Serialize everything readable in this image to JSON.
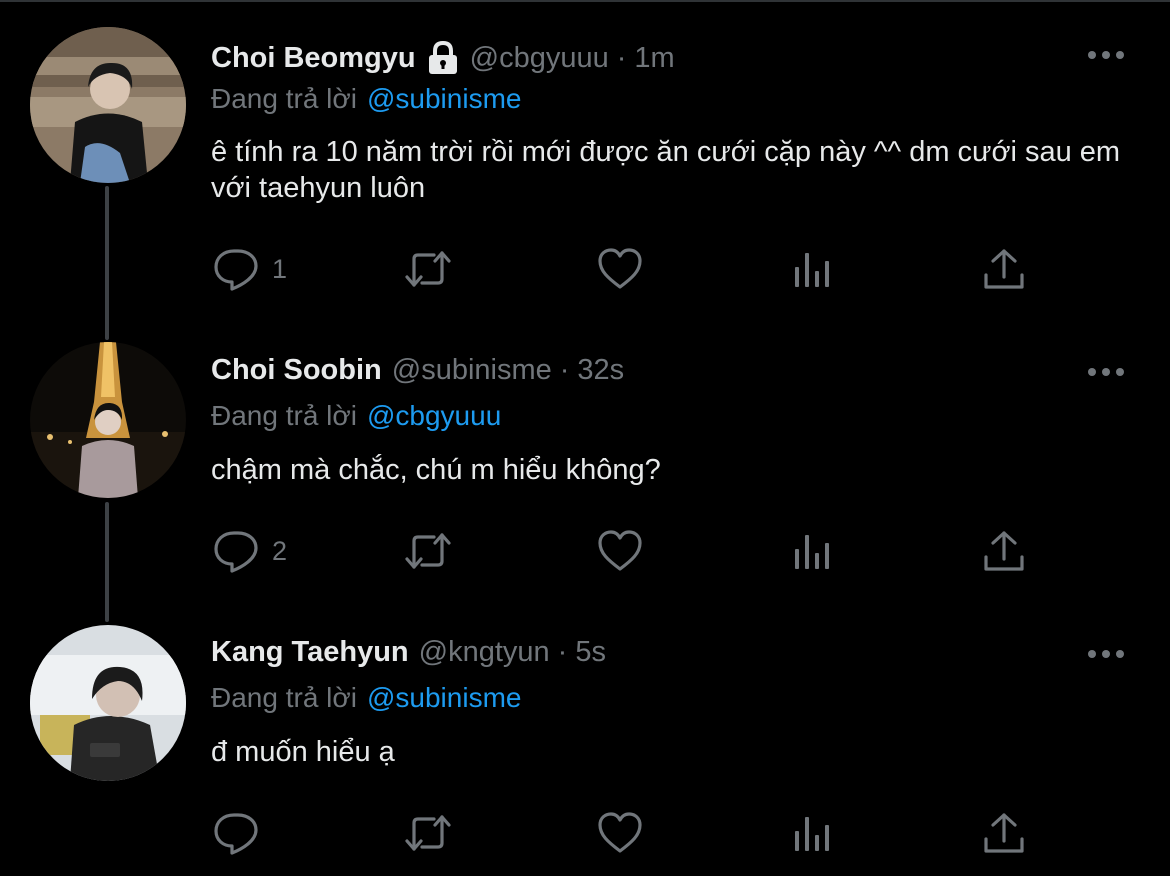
{
  "colors": {
    "background": "#000000",
    "text": "#e7e9ea",
    "muted": "#71767b",
    "link": "#1d9bf0",
    "icon": "#71767b"
  },
  "tweets": [
    {
      "name": "Choi Beomgyu",
      "handle": "@cbgyuuu",
      "dot": "·",
      "time": "1m",
      "protected_icon": "lock-icon",
      "replying_label": "Đang trả lời",
      "mention": "@subinisme",
      "text": "ê tính ra 10 năm trời rồi mới được ăn cưới cặp này ^^ dm cưới sau em với taehyun luôn",
      "reply_count": "1"
    },
    {
      "name": "Choi Soobin",
      "handle": "@subinisme",
      "dot": "·",
      "time": "32s",
      "replying_label": "Đang trả lời",
      "mention": "@cbgyuuu",
      "text": "chậm mà chắc, chú m hiểu không?",
      "reply_count": "2"
    },
    {
      "name": "Kang Taehyun",
      "handle": "@kngtyun",
      "dot": "·",
      "time": "5s",
      "replying_label": "Đang trả lời",
      "mention": "@subinisme",
      "text": "đ muốn hiểu ạ",
      "reply_count": ""
    }
  ],
  "action_icons": [
    "reply-icon",
    "retweet-icon",
    "like-icon",
    "analytics-icon",
    "share-icon"
  ]
}
